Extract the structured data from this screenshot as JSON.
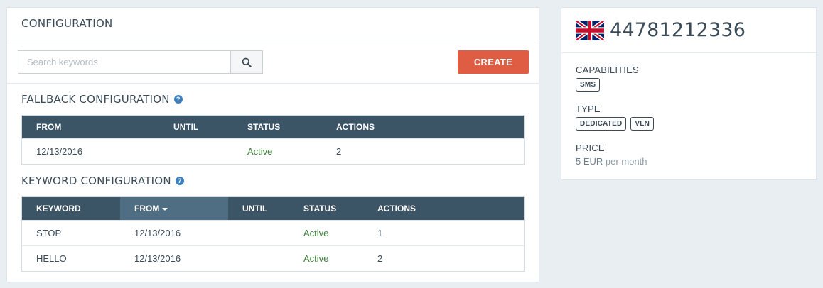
{
  "config": {
    "title": "CONFIGURATION",
    "search": {
      "placeholder": "Search keywords",
      "value": ""
    },
    "create_label": "CREATE",
    "fallback": {
      "title": "FALLBACK CONFIGURATION",
      "columns": [
        "FROM",
        "UNTIL",
        "STATUS",
        "ACTIONS"
      ],
      "rows": [
        {
          "from": "12/13/2016",
          "until": "",
          "status": "Active",
          "actions": "2"
        }
      ]
    },
    "keyword": {
      "title": "KEYWORD CONFIGURATION",
      "columns": [
        "KEYWORD",
        "FROM",
        "UNTIL",
        "STATUS",
        "ACTIONS"
      ],
      "sorted_column": "FROM",
      "sort_direction": "descending",
      "rows": [
        {
          "keyword": "STOP",
          "from": "12/13/2016",
          "until": "",
          "status": "Active",
          "actions": "1"
        },
        {
          "keyword": "HELLO",
          "from": "12/13/2016",
          "until": "",
          "status": "Active",
          "actions": "2"
        }
      ]
    }
  },
  "number": {
    "flag": "uk-flag-icon",
    "value": "44781212336",
    "capabilities_label": "CAPABILITIES",
    "capabilities": [
      "SMS"
    ],
    "type_label": "TYPE",
    "types": [
      "DEDICATED",
      "VLN"
    ],
    "price_label": "PRICE",
    "price_amount": "5 EUR",
    "price_unit": "per month"
  },
  "colors": {
    "accent": "#df5d43",
    "table_header": "#3b5466",
    "sorted_header": "#4f6e83",
    "status_active": "#3d7f3a",
    "help_icon": "#3a7fc0",
    "background": "#e8eef2"
  },
  "icons": {
    "search": "search-icon",
    "help": "help-icon",
    "sort": "sort-desc-caret-icon"
  }
}
